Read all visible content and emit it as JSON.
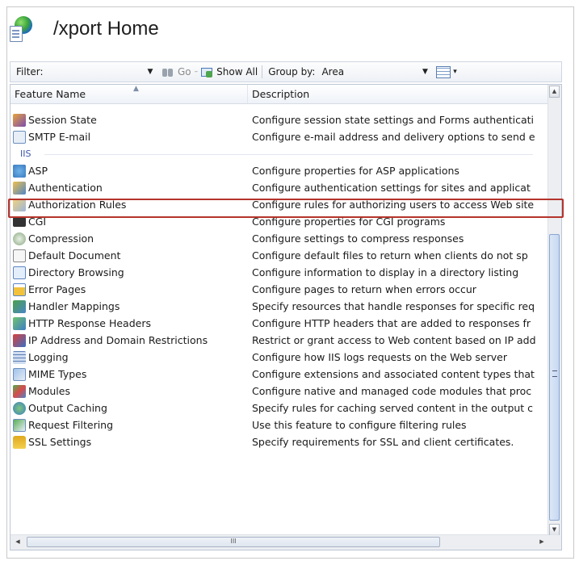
{
  "header": {
    "title": "/xport Home"
  },
  "toolbar": {
    "filter_label": "Filter:",
    "go_label": "Go",
    "show_all_label": "Show All",
    "group_by_label": "Group by:",
    "group_by_value": "Area"
  },
  "columns": {
    "name": "Feature Name",
    "description": "Description"
  },
  "rows_top": [
    {
      "name": "Session State",
      "desc": "Configure session state settings and Forms authenticati",
      "icon": "session-state-icon"
    },
    {
      "name": "SMTP E-mail",
      "desc": "Configure e-mail address and delivery options to send e",
      "icon": "smtp-email-icon"
    }
  ],
  "group_label": "IIS",
  "rows_iis": [
    {
      "name": "ASP",
      "desc": "Configure properties for ASP applications",
      "icon": "asp-icon"
    },
    {
      "name": "Authentication",
      "desc": "Configure authentication settings for sites and applicat",
      "icon": "authentication-icon"
    },
    {
      "name": "Authorization Rules",
      "desc": "Configure rules for authorizing users to access Web site",
      "icon": "authorization-rules-icon"
    },
    {
      "name": "CGI",
      "desc": "Configure properties for CGI programs",
      "icon": "cgi-icon"
    },
    {
      "name": "Compression",
      "desc": "Configure settings to compress responses",
      "icon": "compression-icon"
    },
    {
      "name": "Default Document",
      "desc": "Configure default files to return when clients do not sp",
      "icon": "default-document-icon"
    },
    {
      "name": "Directory Browsing",
      "desc": "Configure information to display in a directory listing",
      "icon": "directory-browsing-icon"
    },
    {
      "name": "Error Pages",
      "desc": "Configure pages to return when errors occur",
      "icon": "error-pages-icon"
    },
    {
      "name": "Handler Mappings",
      "desc": "Specify resources that handle responses for specific req",
      "icon": "handler-mappings-icon"
    },
    {
      "name": "HTTP Response Headers",
      "desc": "Configure HTTP headers that are added to responses fr",
      "icon": "http-response-headers-icon"
    },
    {
      "name": "IP Address and Domain Restrictions",
      "desc": "Restrict or grant access to Web content based on IP add",
      "icon": "ip-restrictions-icon"
    },
    {
      "name": "Logging",
      "desc": "Configure how IIS logs requests on the Web server",
      "icon": "logging-icon"
    },
    {
      "name": "MIME Types",
      "desc": "Configure extensions and associated content types that",
      "icon": "mime-types-icon"
    },
    {
      "name": "Modules",
      "desc": "Configure native and managed code modules that proc",
      "icon": "modules-icon"
    },
    {
      "name": "Output Caching",
      "desc": "Specify rules for caching served content in the output c",
      "icon": "output-caching-icon"
    },
    {
      "name": "Request Filtering",
      "desc": "Use this feature to configure filtering rules",
      "icon": "request-filtering-icon"
    },
    {
      "name": "SSL Settings",
      "desc": "Specify requirements for SSL and client certificates.",
      "icon": "ssl-settings-icon"
    }
  ],
  "highlighted_row": "Authentication",
  "colors": {
    "highlight_border": "#b5342c",
    "group_text": "#3a57a8"
  }
}
